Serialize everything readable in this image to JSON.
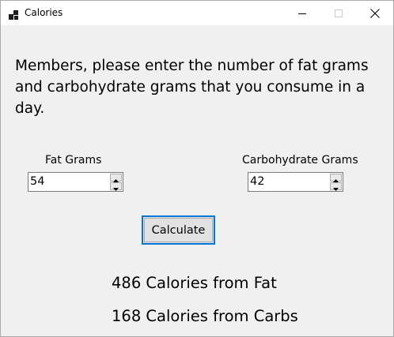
{
  "window": {
    "title": "Calories",
    "app_icon": "winforms-app-icon",
    "controls": {
      "minimize_icon": "minimize-icon",
      "maximize_icon": "maximize-icon",
      "close_icon": "close-icon"
    }
  },
  "form": {
    "prompt": "Members, please enter the number of fat grams and carbohydrate grams that you consume in a day.",
    "fat": {
      "label": "Fat Grams",
      "value": "54"
    },
    "carbs": {
      "label": "Carbohydrate Grams",
      "value": "42"
    },
    "calculate_label": "Calculate",
    "results": {
      "fat": "486 Calories from Fat",
      "carbs": "168 Calories from Carbs"
    }
  },
  "colors": {
    "focus_accent": "#0078d7",
    "form_background": "#f0f0f0"
  }
}
